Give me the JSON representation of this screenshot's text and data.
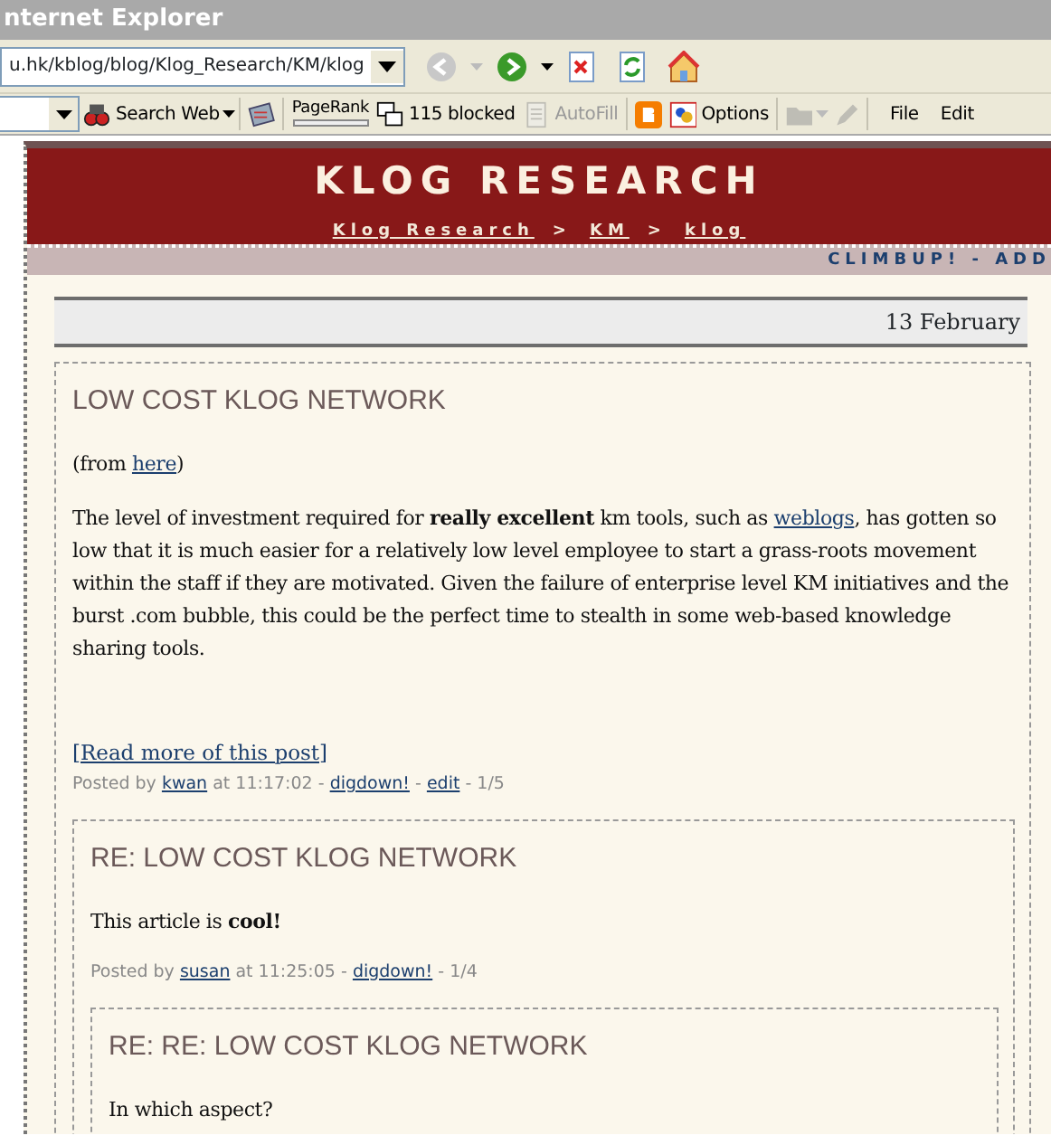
{
  "browser": {
    "title": "nternet Explorer",
    "address": "u.hk/kblog/blog/Klog_Research/KM/klog",
    "nav": [
      {
        "kind": "back",
        "disabled": true
      },
      {
        "kind": "forward",
        "disabled": false
      },
      {
        "kind": "stop",
        "disabled": false
      },
      {
        "kind": "refresh",
        "disabled": false
      },
      {
        "kind": "home",
        "disabled": false
      }
    ],
    "toolbar": [
      {
        "kind": "search",
        "label": "Search Web",
        "disabled": false
      },
      {
        "kind": "news",
        "disabled": false
      },
      {
        "kind": "pagerank",
        "label": "PageRank",
        "disabled": false
      },
      {
        "kind": "blocker",
        "label": "115 blocked",
        "disabled": false
      },
      {
        "kind": "autofill",
        "label": "AutoFill",
        "disabled": true
      },
      {
        "kind": "blogger",
        "disabled": false
      },
      {
        "kind": "options",
        "label": "Options",
        "disabled": false
      },
      {
        "kind": "folder",
        "disabled": true
      },
      {
        "kind": "pencil",
        "disabled": true
      }
    ],
    "menu": [
      "File",
      "Edit"
    ]
  },
  "site": {
    "title": "KLOG RESEARCH",
    "breadcrumb": [
      "Klog Research",
      "KM",
      "klog"
    ],
    "separator": ">",
    "actions": "CLIMBUP! - ADD"
  },
  "date": "13 February",
  "posts": [
    {
      "title": "LOW COST KLOG NETWORK",
      "paragraphs": [
        [
          {
            "kind": "text",
            "text": "(from "
          },
          {
            "kind": "link",
            "text": "here"
          },
          {
            "kind": "text",
            "text": ")"
          }
        ],
        [
          {
            "kind": "text",
            "text": "The level of investment required for **really excellent** km tools, such as "
          },
          {
            "kind": "link",
            "text": "weblogs"
          },
          {
            "kind": "text",
            "text": ", has gotten so low that it is much easier for a relatively low level employee to start a grass-roots movement within the staff if they are motivated. Given the failure of enterprise level KM initiatives and the burst .com bubble, this could be the perfect time to stealth in some web-based knowledge sharing tools."
          }
        ]
      ],
      "read_more": "[Read more of this post]",
      "meta": [
        {
          "kind": "text",
          "text": "Posted by "
        },
        {
          "kind": "link",
          "text": "kwan"
        },
        {
          "kind": "text",
          "text": " at 11:17:02 - "
        },
        {
          "kind": "link",
          "text": "digdown!"
        },
        {
          "kind": "text",
          "text": " - "
        },
        {
          "kind": "link",
          "text": "edit"
        },
        {
          "kind": "text",
          "text": " - 1/5"
        }
      ],
      "replies": [
        {
          "title": "RE: LOW COST KLOG NETWORK",
          "paragraphs": [
            [
              {
                "kind": "text",
                "text": "This article is **cool!**"
              }
            ]
          ],
          "meta": [
            {
              "kind": "text",
              "text": "Posted by "
            },
            {
              "kind": "link",
              "text": "susan"
            },
            {
              "kind": "text",
              "text": " at 11:25:05 - "
            },
            {
              "kind": "link",
              "text": "digdown!"
            },
            {
              "kind": "text",
              "text": " - 1/4"
            }
          ],
          "replies": [
            {
              "title": "RE: RE: LOW COST KLOG NETWORK",
              "paragraphs": [
                [
                  {
                    "kind": "text",
                    "text": "In which aspect?"
                  }
                ]
              ]
            }
          ]
        }
      ]
    }
  ]
}
